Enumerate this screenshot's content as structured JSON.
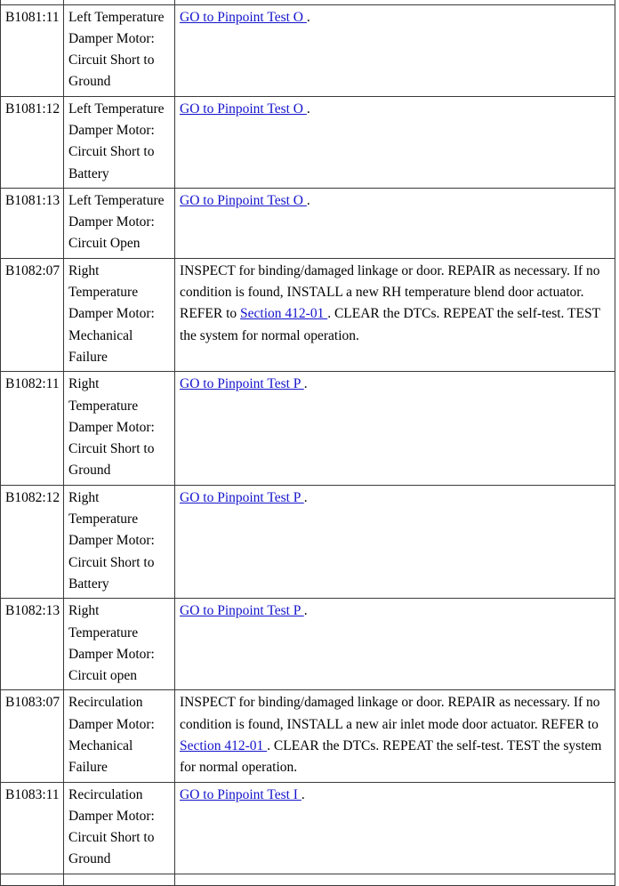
{
  "table": {
    "link_color": "#1414cc",
    "border_color": "#3a3a3a",
    "rows": [
      {
        "code": "B1081:11",
        "description": "Left Temperature Damper Motor: Circuit Short to Ground",
        "action_prefix": "",
        "action_link": "GO to Pinpoint Test O ",
        "action_suffix": "."
      },
      {
        "code": "B1081:12",
        "description": "Left Temperature Damper Motor: Circuit Short to Battery",
        "action_prefix": "",
        "action_link": "GO to Pinpoint Test O ",
        "action_suffix": "."
      },
      {
        "code": "B1081:13",
        "description": "Left Temperature Damper Motor: Circuit Open",
        "action_prefix": "",
        "action_link": "GO to Pinpoint Test O ",
        "action_suffix": "."
      },
      {
        "code": "B1082:07",
        "description": "Right Temperature Damper Motor: Mechanical Failure",
        "action_prefix": "INSPECT for binding/damaged linkage or door. REPAIR as necessary. If no condition is found, INSTALL a new RH temperature blend door actuator. REFER to ",
        "action_link": "Section 412-01 ",
        "action_suffix": ". CLEAR the DTCs. REPEAT the self-test. TEST the system for normal operation."
      },
      {
        "code": "B1082:11",
        "description": "Right Temperature Damper Motor: Circuit Short to Ground",
        "action_prefix": "",
        "action_link": "GO to Pinpoint Test P ",
        "action_suffix": "."
      },
      {
        "code": "B1082:12",
        "description": "Right Temperature Damper Motor: Circuit Short to Battery",
        "action_prefix": "",
        "action_link": "GO to Pinpoint Test P ",
        "action_suffix": "."
      },
      {
        "code": "B1082:13",
        "description": "Right Temperature Damper Motor: Circuit open",
        "action_prefix": "",
        "action_link": "GO to Pinpoint Test P ",
        "action_suffix": "."
      },
      {
        "code": "B1083:07",
        "description": "Recirculation Damper Motor: Mechanical Failure",
        "action_prefix": "INSPECT for binding/damaged linkage or door. REPAIR as necessary. If no condition is found, INSTALL a new air inlet mode door actuator. REFER to ",
        "action_link": "Section 412-01 ",
        "action_suffix": ". CLEAR the DTCs. REPEAT the self-test. TEST the system for normal operation."
      },
      {
        "code": "B1083:11",
        "description": "Recirculation Damper Motor: Circuit Short to Ground",
        "action_prefix": "",
        "action_link": "GO to Pinpoint Test I ",
        "action_suffix": "."
      }
    ]
  }
}
